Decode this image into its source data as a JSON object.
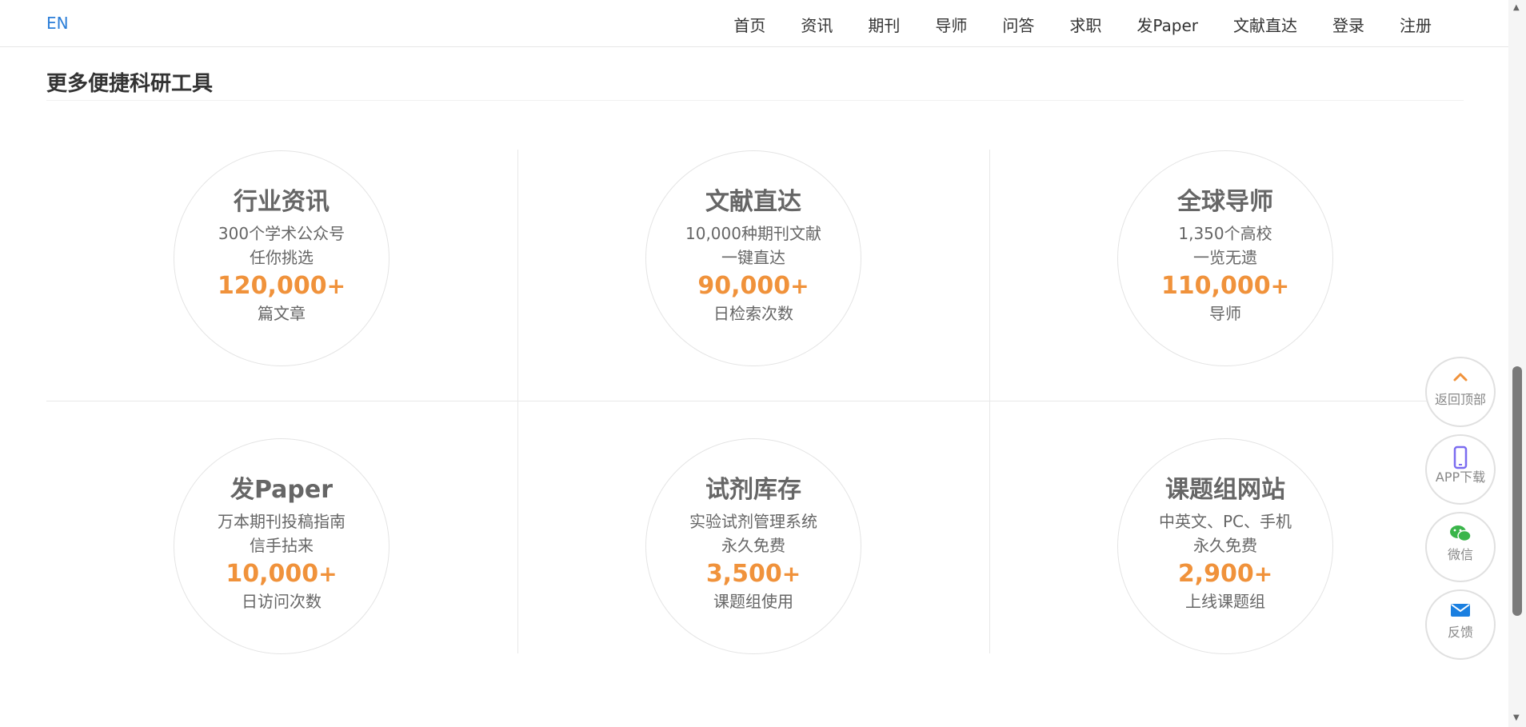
{
  "header": {
    "lang_switch": "EN",
    "nav": [
      "首页",
      "资讯",
      "期刊",
      "导师",
      "问答",
      "求职",
      "发Paper",
      "文献直达",
      "登录",
      "注册"
    ]
  },
  "section": {
    "title": "更多便捷科研工具"
  },
  "tools": [
    {
      "title": "行业资讯",
      "line1": "300个学术公众号",
      "line2": "任你挑选",
      "number": "120,000",
      "suffix": "+",
      "unit": "篇文章"
    },
    {
      "title": "文献直达",
      "line1": "10,000种期刊文献",
      "line2": "一键直达",
      "number": "90,000",
      "suffix": "+",
      "unit": "日检索次数"
    },
    {
      "title": "全球导师",
      "line1": "1,350个高校",
      "line2": "一览无遗",
      "number": "110,000",
      "suffix": "+",
      "unit": "导师"
    },
    {
      "title": "发Paper",
      "line1": "万本期刊投稿指南",
      "line2": "信手拈来",
      "number": "10,000",
      "suffix": "+",
      "unit": "日访问次数"
    },
    {
      "title": "试剂库存",
      "line1": "实验试剂管理系统",
      "line2": "永久免费",
      "number": "3,500",
      "suffix": "+",
      "unit": "课题组使用"
    },
    {
      "title": "课题组网站",
      "line1": "中英文、PC、手机",
      "line2": "永久免费",
      "number": "2,900",
      "suffix": "+",
      "unit": "上线课题组"
    }
  ],
  "floating": {
    "back_to_top": "返回顶部",
    "app_download": "APP下载",
    "wechat": "微信",
    "feedback": "反馈"
  },
  "colors": {
    "accent_number": "#f0923b",
    "lang_link": "#2b7ed8",
    "wechat_green": "#3ab54a",
    "phone_purple": "#7b6cf0",
    "mail_blue": "#1a7fe0",
    "arrow_orange": "#f0923b"
  }
}
